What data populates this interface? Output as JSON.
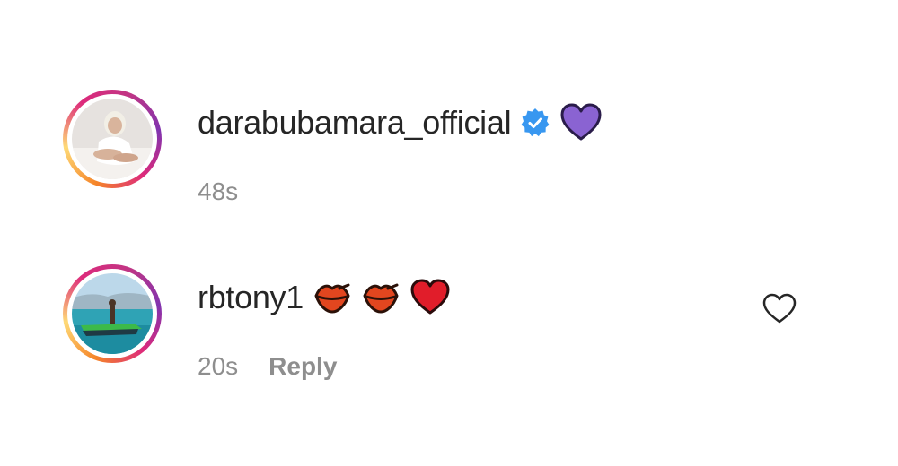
{
  "comments": [
    {
      "username": "darabubamara_official",
      "verified": true,
      "text_emojis": [
        "purple-heart"
      ],
      "time": "48s",
      "reply_label": ""
    },
    {
      "username": "rbtony1",
      "verified": false,
      "text_emojis": [
        "kiss-mark",
        "kiss-mark",
        "red-heart"
      ],
      "time": "20s",
      "reply_label": "Reply"
    }
  ],
  "colors": {
    "text": "#262626",
    "muted": "#8e8e8e",
    "verified_blue": "#3897f0",
    "purple_heart": "#8a63d2",
    "red_heart": "#e11d2a"
  }
}
